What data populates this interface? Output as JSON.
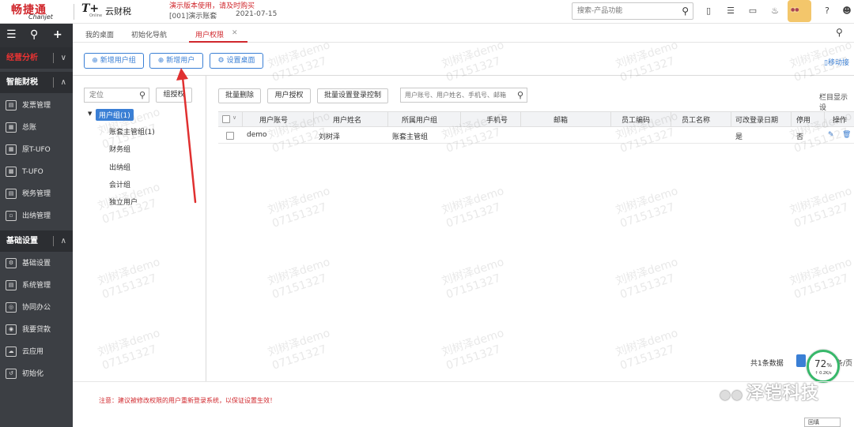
{
  "topbar": {
    "brand_name": "畅捷通",
    "brand_sub": "Chanjet",
    "product_logo": "T+",
    "product_logo_sub": "Online",
    "product_name": "云财税",
    "demo_notice": "演示版本使用，请及时购买",
    "company": "[001]演示账套",
    "date": "2021-07-15",
    "search_placeholder": "搜索-产品功能",
    "icons": [
      "phone-icon",
      "todo-list-icon",
      "video-icon",
      "bell-icon",
      "avatar-icon",
      "help-icon",
      "user-icon"
    ]
  },
  "sidebar": {
    "sections": [
      {
        "label": "经营分析",
        "state": "collapsed"
      },
      {
        "label": "智能财税",
        "state": "expanded"
      },
      {
        "label": "基础设置",
        "state": "expanded"
      }
    ],
    "finance_items": [
      {
        "label": "发票管理",
        "icon": "invoice-icon"
      },
      {
        "label": "总账",
        "icon": "ledger-icon"
      },
      {
        "label": "原T-UFO",
        "icon": "ufo-icon"
      },
      {
        "label": "T-UFO",
        "icon": "report-icon"
      },
      {
        "label": "税务管理",
        "icon": "tax-icon"
      },
      {
        "label": "出纳管理",
        "icon": "cashier-icon"
      }
    ],
    "basic_items": [
      {
        "label": "基础设置",
        "icon": "settings-icon"
      },
      {
        "label": "系统管理",
        "icon": "system-icon"
      },
      {
        "label": "协同办公",
        "icon": "collab-icon"
      },
      {
        "label": "我要贷款",
        "icon": "loan-icon"
      },
      {
        "label": "云应用",
        "icon": "cloud-icon"
      },
      {
        "label": "初始化",
        "icon": "init-icon"
      }
    ]
  },
  "tabs": {
    "items": [
      "我的桌面",
      "初始化导航",
      "用户权限"
    ],
    "active": "用户权限"
  },
  "toolbar": {
    "new_group": "新增用户组",
    "new_user": "新增用户",
    "set_desktop": "设置桌面",
    "move_link": "移动接"
  },
  "tree_panel": {
    "locate_placeholder": "定位",
    "group_auth_button": "组授权",
    "root": "用户组(1)",
    "children": [
      "账套主管组(1)",
      "财务组",
      "出纳组",
      "会计组",
      "独立用户"
    ]
  },
  "actions": {
    "batch_delete": "批量删除",
    "user_auth": "用户授权",
    "batch_login": "批量设置登录控制",
    "filter_placeholder": "用户账号、用户姓名、手机号、邮箱",
    "column_settings": "栏目显示设"
  },
  "table": {
    "columns": [
      "用户账号",
      "用户姓名",
      "所属用户组",
      "手机号",
      "邮箱",
      "员工编码",
      "员工名称",
      "可改登录日期",
      "停用",
      "操作"
    ],
    "rows": [
      {
        "account": "demo",
        "name": "刘树泽",
        "group": "账套主管组",
        "phone": "",
        "email": "",
        "emp_code": "",
        "emp_name": "",
        "can_change_date": "是",
        "disabled": "否"
      }
    ]
  },
  "pagination": {
    "total": "共1条数据",
    "per_page": "条/页",
    "page": ""
  },
  "network_gauge": {
    "percent": "72",
    "percent_unit": "%",
    "speed": "0.2K/s"
  },
  "notice": "注意：建议被修改权限的用户重新登录系统，以保证设置生效！",
  "watermark": {
    "name": "刘树泽demo",
    "code": "07151327",
    "brand": "泽铠科技"
  },
  "bottom_box": "回填",
  "colors": {
    "brand_red": "#d0272c",
    "accent_blue": "#3a7fd5",
    "sidebar_bg": "#3c3f44",
    "gauge_green": "#37b86a"
  }
}
